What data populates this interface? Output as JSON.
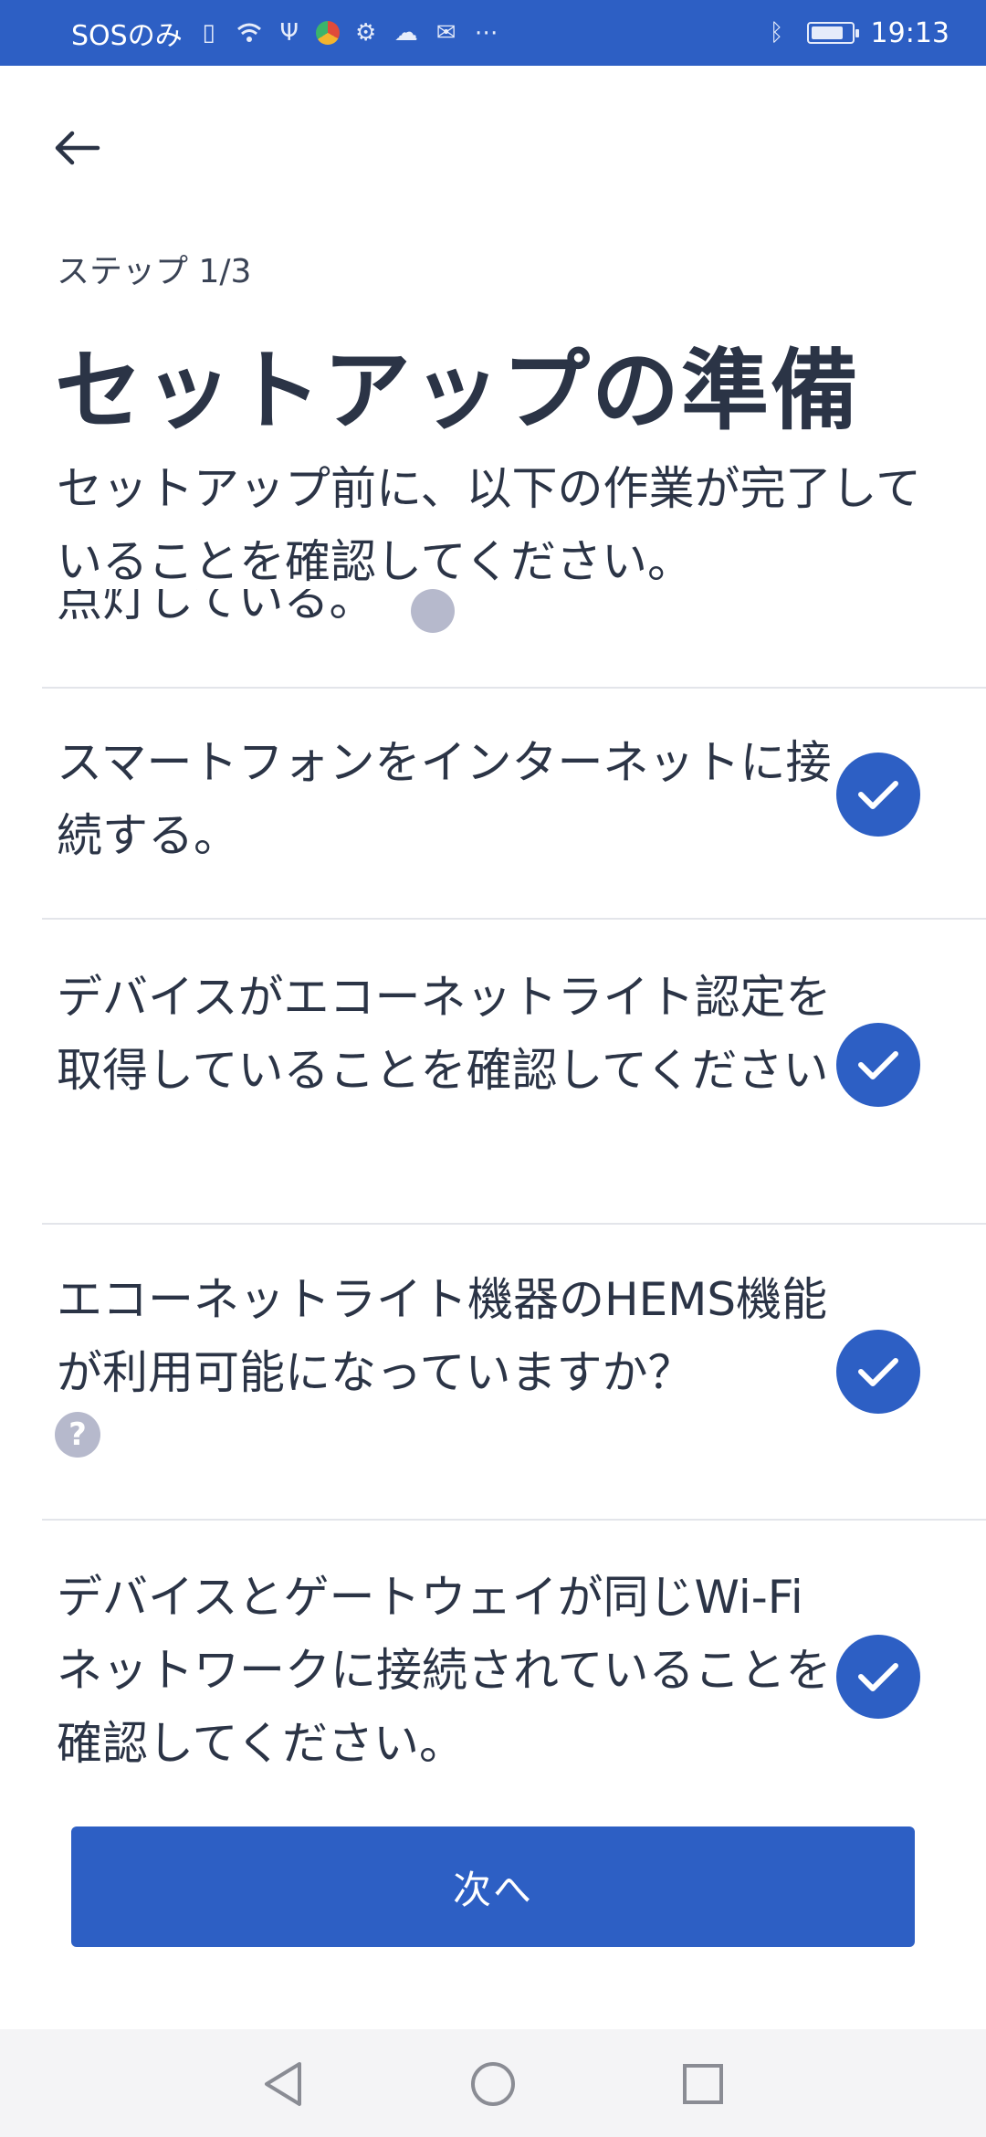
{
  "status_bar": {
    "carrier": "SOSのみ",
    "time": "19:13",
    "icons": [
      "sim-icon",
      "wifi-icon",
      "usb-icon",
      "browser-icon",
      "settings-icon",
      "cloud-icon",
      "notification-icon",
      "more-icon",
      "bluetooth-icon",
      "battery-icon"
    ]
  },
  "header": {
    "step": "ステップ 1/3",
    "title": "セットアップの準備",
    "subtitle": "セットアップ前に、以下の作業が完了していることを確認してください。"
  },
  "checklist": {
    "clipped_item": "点灯している。",
    "items": [
      {
        "label": "スマートフォンをインターネットに接続する。",
        "checked": true
      },
      {
        "label": "デバイスがエコーネットライト認定を取得していることを確認してください",
        "checked": true
      },
      {
        "label": "エコーネットライト機器のHEMS機能が利用可能になっていますか？",
        "checked": true,
        "help": "?"
      },
      {
        "label": "デバイスとゲートウェイが同じWi-Fiネットワークに接続されていることを確認してください。",
        "checked": true
      }
    ]
  },
  "footer": {
    "next_label": "次へ"
  },
  "colors": {
    "primary": "#2d5fc4",
    "text": "#2b3446",
    "divider": "#e3e5ea",
    "help": "#b6b9cc"
  }
}
